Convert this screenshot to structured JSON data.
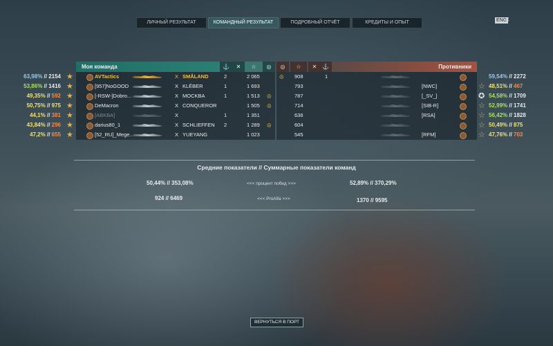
{
  "tabs": [
    "Личный результат",
    "Командный результат",
    "Подробный отчёт",
    "Кредиты и опыт"
  ],
  "active_tab": 1,
  "lang_badge": "ENG",
  "my_team": {
    "title": "Моя команда",
    "rows": [
      {
        "wr": "63,98%",
        "battles": "2154",
        "wr_color": "blue",
        "battles_color": "white",
        "player": "AVTactics",
        "ship": "SMÅLAND",
        "kills": "2",
        "score": "2 065",
        "highlight": true,
        "ribbon": false,
        "dead": false
      },
      {
        "wr": "53,86%",
        "battles": "1416",
        "wr_color": "green",
        "battles_color": "white",
        "player": "[957]NoGOOD",
        "ship": "KLÉBER",
        "kills": "1",
        "score": "1 693",
        "highlight": false,
        "ribbon": false,
        "dead": false
      },
      {
        "wr": "49,35%",
        "battles": "592",
        "wr_color": "yellow",
        "battles_color": "orange",
        "player": "[-RSW-]Dobro...",
        "ship": "MOCKBA",
        "kills": "1",
        "score": "1 513",
        "highlight": false,
        "ribbon": true,
        "dead": false
      },
      {
        "wr": "50,75%",
        "battles": "975",
        "wr_color": "yellow",
        "battles_color": "yellow",
        "player": "DeMacron",
        "ship": "CONQUEROR",
        "kills": "",
        "score": "1 505",
        "highlight": false,
        "ribbon": true,
        "dead": false
      },
      {
        "wr": "44,1%",
        "battles": "381",
        "wr_color": "yellow",
        "battles_color": "orange",
        "player": "[ABKBA]",
        "ship": "",
        "kills": "1",
        "score": "1 351",
        "highlight": false,
        "ribbon": false,
        "dead": true
      },
      {
        "wr": "43,84%",
        "battles": "296",
        "wr_color": "yellow",
        "battles_color": "orange",
        "player": "darius80_1",
        "ship": "SCHLIEFFEN",
        "kills": "2",
        "score": "1 289",
        "highlight": false,
        "ribbon": true,
        "dead": false
      },
      {
        "wr": "47,2%",
        "battles": "655",
        "wr_color": "yellow",
        "battles_color": "orange",
        "player": "[52_RU]_Mege...",
        "ship": "YUEYANG",
        "kills": "",
        "score": "1 023",
        "highlight": false,
        "ribbon": false,
        "dead": false
      }
    ]
  },
  "enemy_team": {
    "title": "Противники",
    "rows": [
      {
        "score": "908",
        "kills": "1",
        "ribbon": true,
        "wr": "59,54%",
        "battles": "2272",
        "wr_color": "blue",
        "battles_color": "white",
        "player": "",
        "ship": "",
        "star": ""
      },
      {
        "score": "793",
        "kills": "",
        "ribbon": false,
        "wr": "48,51%",
        "battles": "467",
        "wr_color": "yellow",
        "battles_color": "orange",
        "player": "[NWC]",
        "ship": "",
        "star": "outline"
      },
      {
        "score": "787",
        "kills": "",
        "ribbon": false,
        "wr": "54,58%",
        "battles": "1709",
        "wr_color": "green",
        "battles_color": "white",
        "player": "[_SV_]",
        "ship": "",
        "star": "badge"
      },
      {
        "score": "714",
        "kills": "",
        "ribbon": false,
        "wr": "52,99%",
        "battles": "1741",
        "wr_color": "green",
        "battles_color": "white",
        "player": "[SIB-R]",
        "ship": "",
        "star": "outline"
      },
      {
        "score": "636",
        "kills": "",
        "ribbon": false,
        "wr": "56,42%",
        "battles": "1828",
        "wr_color": "green",
        "battles_color": "white",
        "player": "[RSA]",
        "ship": "",
        "star": "outline"
      },
      {
        "score": "604",
        "kills": "",
        "ribbon": false,
        "wr": "50,49%",
        "battles": "875",
        "wr_color": "yellow",
        "battles_color": "yellow",
        "player": "",
        "ship": "",
        "star": "outline"
      },
      {
        "score": "545",
        "kills": "",
        "ribbon": false,
        "wr": "47,76%",
        "battles": "703",
        "wr_color": "yellow",
        "battles_color": "orange",
        "player": "[RFM]",
        "ship": "",
        "star": "outline"
      }
    ]
  },
  "summary": {
    "title": "Средние показатели // Суммарные показатели команд",
    "my_wr": "50,44% // 353,08%",
    "wr_label": "<<< процент побед >>>",
    "enemy_wr": "52,89% // 370,29%",
    "my_pr": "924 // 6469",
    "pr_label": "<<< ProAlfa >>>",
    "enemy_pr": "1370 // 9595"
  },
  "back_button": "Вернуться в порт",
  "icons": {
    "star": "star-icon",
    "medal": "rank-medal-icon",
    "ship": "ship-silhouette-icon"
  }
}
